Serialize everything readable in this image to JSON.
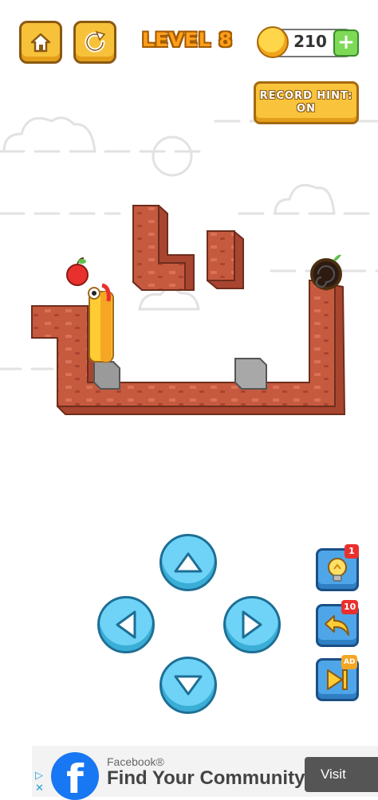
{
  "hud": {
    "level_label": "LEVEL 8",
    "coins": "210",
    "plus_symbol": "+",
    "record_hint_line1": "RECORD HINT:",
    "record_hint_line2": "ON",
    "icons": [
      "home-icon",
      "restart-icon",
      "coin-icon",
      "plus-icon"
    ]
  },
  "controls": {
    "dpad": [
      "up-arrow-icon",
      "left-arrow-icon",
      "right-arrow-icon",
      "down-arrow-icon"
    ],
    "hint_badge": "1",
    "undo_badge": "10",
    "skip_badge": "AD",
    "icons": [
      "lightbulb-icon",
      "undo-icon",
      "skip-level-icon"
    ]
  },
  "ad": {
    "brand": "Facebook®",
    "headline": "Find Your Community",
    "cta": "Visit",
    "logo_letter": "f",
    "choices_glyph": "▷",
    "close_glyph": "✕"
  },
  "colors": {
    "brick": "#c65a3f",
    "button_yellow": "#f7c23a",
    "dpad_blue": "#6fd3f7",
    "side_blue": "#4ea6e8",
    "worm_yellow": "#ffcc33",
    "level_orange": "#ff9f1a"
  }
}
